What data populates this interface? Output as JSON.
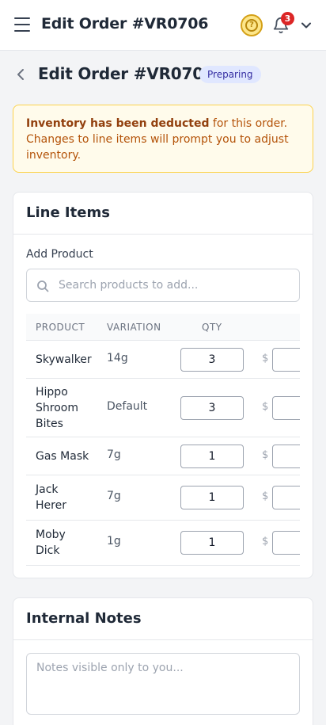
{
  "header": {
    "title": "Edit Order #VR0706",
    "notification_count": "3",
    "help_glyph": "?"
  },
  "page": {
    "title": "Edit Order #VR0706",
    "status": "Preparing",
    "status_color": "#e0e7ff"
  },
  "alert": {
    "bold_text": "Inventory has been deducted",
    "text": " for this order. Changes to line items will prompt you to adjust inventory."
  },
  "line_items": {
    "heading": "Line Items",
    "add_product_label": "Add Product",
    "search_placeholder": "Search products to add...",
    "columns": [
      "PRODUCT",
      "VARIATION",
      "QTY"
    ],
    "currency_symbol": "$",
    "rows": [
      {
        "product": "Skywalker",
        "variation": "14g",
        "qty": "3"
      },
      {
        "product": "Hippo Shroom Bites",
        "variation": "Default",
        "qty": "3"
      },
      {
        "product": "Gas Mask",
        "variation": "7g",
        "qty": "1"
      },
      {
        "product": "Jack Herer",
        "variation": "7g",
        "qty": "1"
      },
      {
        "product": "Moby Dick",
        "variation": "1g",
        "qty": "1"
      }
    ]
  },
  "notes": {
    "heading": "Internal Notes",
    "placeholder": "Notes visible only to you..."
  },
  "colors": {
    "accent_badge": "#dc2626",
    "alert_bg": "#fffbeb",
    "alert_border": "#fcd34d"
  }
}
